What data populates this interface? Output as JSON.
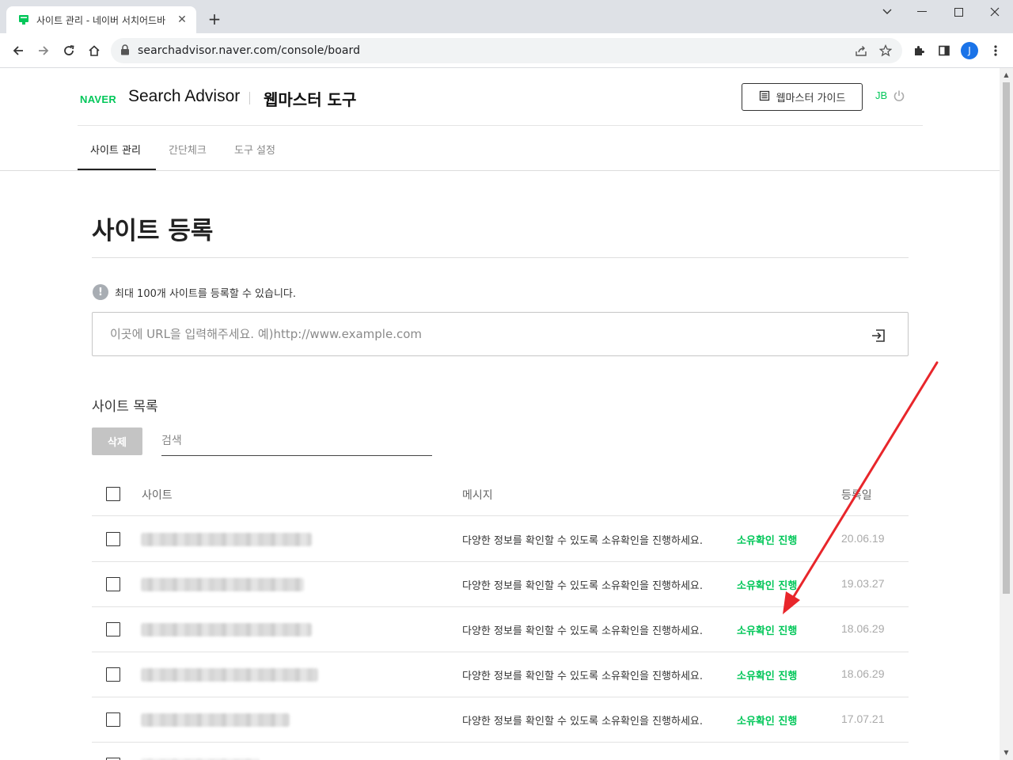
{
  "browser": {
    "tab_title": "사이트 관리 - 네이버 서치어드바",
    "url": "searchadvisor.naver.com/console/board",
    "profile_initial": "J"
  },
  "header": {
    "logo": "NAVER",
    "app_name": "Search Advisor",
    "tool_name": "웹마스터 도구",
    "guide_button": "웹마스터 가이드",
    "user_id": "JB"
  },
  "nav": {
    "tabs": [
      {
        "label": "사이트 관리",
        "active": true
      },
      {
        "label": "간단체크",
        "active": false
      },
      {
        "label": "도구 설정",
        "active": false
      }
    ]
  },
  "main": {
    "title": "사이트 등록",
    "info_text": "최대 100개 사이트를 등록할 수 있습니다.",
    "url_input": {
      "placeholder": "이곳에 URL을 입력해주세요. 예)http://www.example.com",
      "value": ""
    },
    "list_title": "사이트 목록",
    "delete_button": "삭제",
    "search": {
      "placeholder": "검색",
      "value": ""
    },
    "columns": {
      "site": "사이트",
      "message": "메시지",
      "date": "등록일"
    },
    "rows": [
      {
        "message": "다양한 정보를 확인할 수 있도록 소유확인을 진행하세요.",
        "action": "소유확인 진행",
        "date": "20.06.19"
      },
      {
        "message": "다양한 정보를 확인할 수 있도록 소유확인을 진행하세요.",
        "action": "소유확인 진행",
        "date": "19.03.27"
      },
      {
        "message": "다양한 정보를 확인할 수 있도록 소유확인을 진행하세요.",
        "action": "소유확인 진행",
        "date": "18.06.29"
      },
      {
        "message": "다양한 정보를 확인할 수 있도록 소유확인을 진행하세요.",
        "action": "소유확인 진행",
        "date": "18.06.29"
      },
      {
        "message": "다양한 정보를 확인할 수 있도록 소유확인을 진행하세요.",
        "action": "소유확인 진행",
        "date": "17.07.21"
      }
    ]
  },
  "colors": {
    "naver_green": "#03c75a",
    "annotation_arrow": "#e8262b"
  }
}
